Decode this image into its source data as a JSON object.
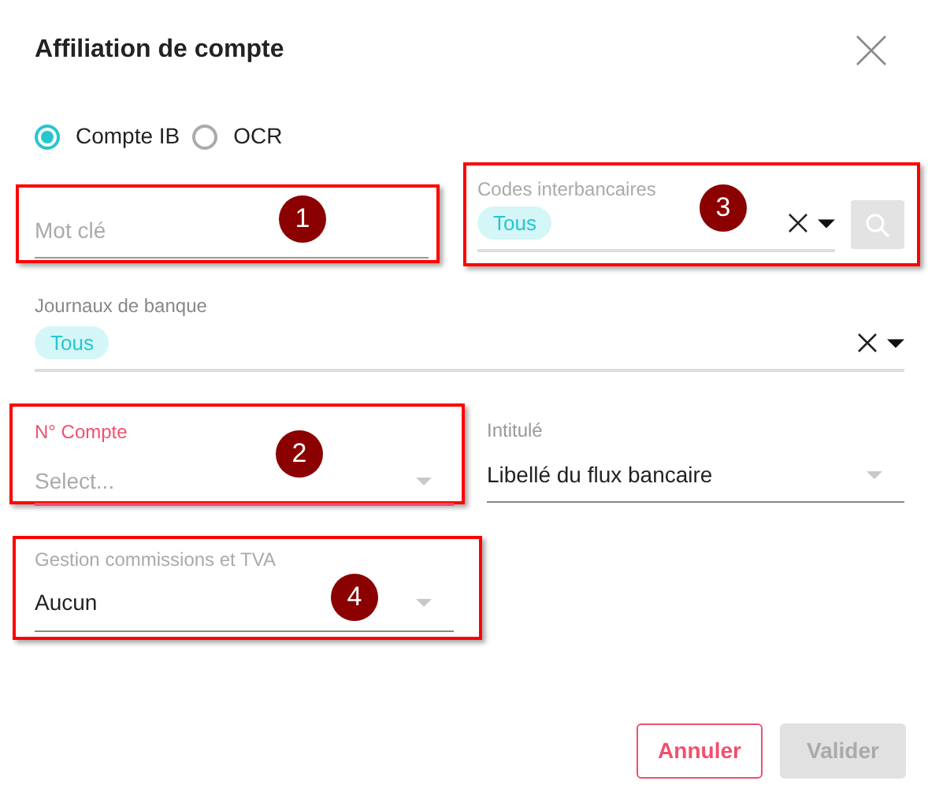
{
  "dialog": {
    "title": "Affiliation de compte"
  },
  "mode_options": [
    {
      "label": "Compte IB",
      "selected": true
    },
    {
      "label": "OCR",
      "selected": false
    }
  ],
  "keyword": {
    "placeholder": "Mot clé",
    "callout": "1"
  },
  "interbank_codes": {
    "label": "Codes interbancaires",
    "chips": [
      "Tous"
    ],
    "callout": "3"
  },
  "bank_journals": {
    "label": "Journaux de banque",
    "chips": [
      "Tous"
    ]
  },
  "account_number": {
    "label": "N° Compte",
    "placeholder": "Select...",
    "error": true,
    "callout": "2"
  },
  "title_field": {
    "label": "Intitulé",
    "value": "Libellé du flux bancaire"
  },
  "fees_vat": {
    "label": "Gestion commissions et TVA",
    "value": "Aucun",
    "callout": "4"
  },
  "buttons": [
    {
      "label": "Annuler",
      "kind": "secondary",
      "disabled": false
    },
    {
      "label": "Valider",
      "kind": "primary",
      "disabled": true
    }
  ]
}
